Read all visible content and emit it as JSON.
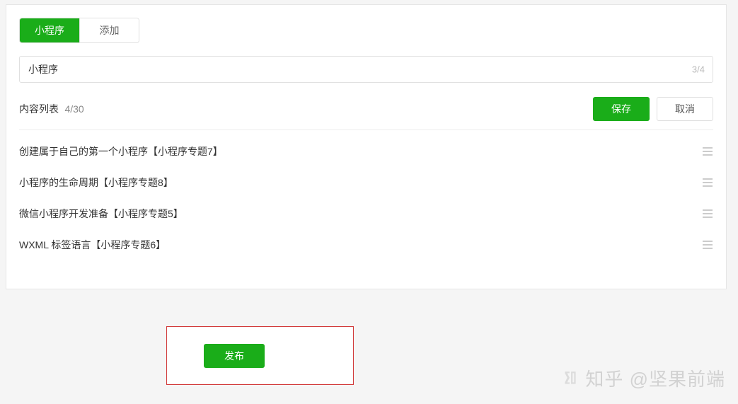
{
  "tabs": {
    "primary": "小程序",
    "secondary": "添加"
  },
  "input": {
    "value": "小程序",
    "counter": "3/4"
  },
  "list": {
    "title": "内容列表",
    "count": "4/30",
    "save": "保存",
    "cancel": "取消",
    "items": [
      "创建属于自己的第一个小程序【小程序专题7】",
      "小程序的生命周期【小程序专题8】",
      "微信小程序开发准备【小程序专题5】",
      "WXML 标签语言【小程序专题6】"
    ]
  },
  "publish": {
    "label": "发布"
  },
  "watermark": {
    "text": "知乎 @坚果前端"
  }
}
